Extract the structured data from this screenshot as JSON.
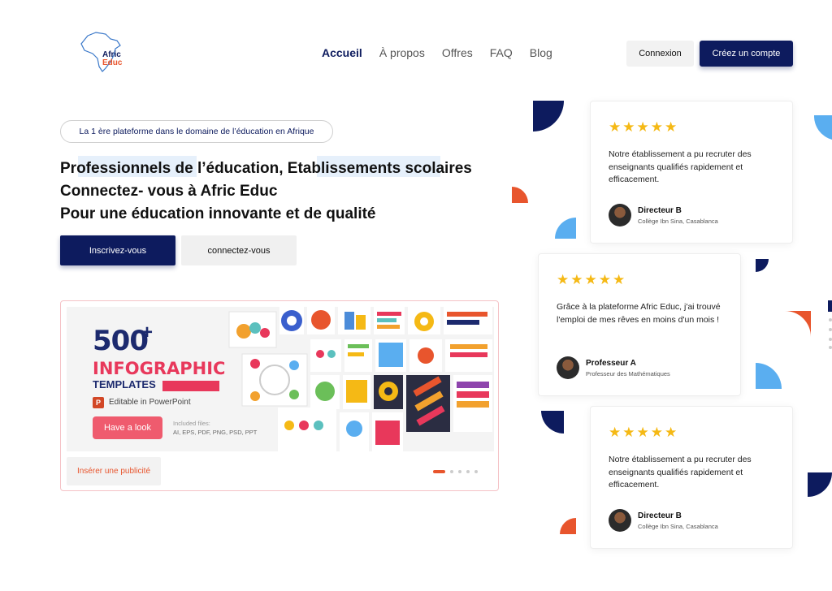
{
  "brand": {
    "logo_line1": "Afric",
    "logo_line2": "Educ"
  },
  "nav": {
    "items": [
      {
        "label": "Accueil"
      },
      {
        "label": "À propos"
      },
      {
        "label": "Offres"
      },
      {
        "label": "FAQ"
      },
      {
        "label": "Blog"
      }
    ],
    "login_label": "Connexion",
    "signup_label": "Créez un compte"
  },
  "hero": {
    "pill": "La 1 ère plateforme dans le domaine de l’éducation en Afrique",
    "headline_lines": [
      "Professionnels de l’éducation, Etablissements scolaires",
      "Connectez- vous à Afric Educ",
      "Pour une éducation innovante et de qualité"
    ],
    "primary_button": "Inscrivez-vous",
    "secondary_button": "connectez-vous"
  },
  "ad": {
    "number": "500",
    "plus": "+",
    "title": "INFOGRAPHIC",
    "subtitle": "TEMPLATES",
    "ppt_text": "Editable in PowerPoint",
    "cta": "Have a look",
    "files_label": "Included files:",
    "files": "AI, EPS, PDF, PNG, PSD, PPT",
    "insert_label": "Insérer une publicité",
    "slides_total": 5,
    "slide_active": 1
  },
  "testimonials": [
    {
      "stars": "★★★★★",
      "quote": "Notre établissement a pu recruter des enseignants qualifiés rapidement et efficacement.",
      "name": "Directeur B",
      "role": "Collège Ibn Sina, Casablanca"
    },
    {
      "stars": "★★★★★",
      "quote": "Grâce à la plateforme Afric Educ, j'ai trouvé l'emploi de mes rêves en moins d'un mois !",
      "name": "Professeur A",
      "role": "Professeur des Mathématiques"
    },
    {
      "stars": "★★★★★",
      "quote": "Notre établissement a pu recruter des enseignants qualifiés rapidement et efficacement.",
      "name": "Directeur B",
      "role": "Collège Ibn Sina, Casablanca"
    }
  ],
  "colors": {
    "navy": "#0d1b5e",
    "orange": "#e8552d",
    "sky": "#5aaef0",
    "star": "#f5b915",
    "pink": "#ef5b6e"
  }
}
